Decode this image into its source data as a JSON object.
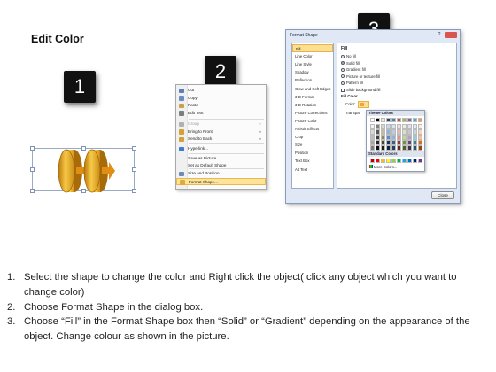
{
  "title": "Edit Color",
  "steps": {
    "one": "1",
    "two": "2",
    "three": "3"
  },
  "context_menu": {
    "items": [
      {
        "label": "Cut",
        "icon": "scissors-icon",
        "color": "#5b7fb8"
      },
      {
        "label": "Copy",
        "icon": "copy-icon",
        "color": "#6b8cc4"
      },
      {
        "label": "Paste",
        "icon": "paste-icon",
        "color": "#c8a148"
      },
      {
        "label": "Edit Text",
        "icon": "edit-text-icon",
        "color": "#7c7c7c"
      },
      {
        "label": "Group",
        "icon": "group-icon",
        "color": "#b0b0b0",
        "disabled": true,
        "submenu": true
      },
      {
        "label": "Bring to Front",
        "icon": "bring-front-icon",
        "color": "#d3a03c",
        "submenu": true
      },
      {
        "label": "Send to Back",
        "icon": "send-back-icon",
        "color": "#d3a03c",
        "submenu": true
      },
      {
        "label": "Hyperlink...",
        "icon": "hyperlink-icon",
        "color": "#3d7ad1"
      },
      {
        "label": "Save as Picture...",
        "icon": "none",
        "color": ""
      },
      {
        "label": "Set as Default Shape",
        "icon": "none",
        "color": ""
      },
      {
        "label": "Size and Position...",
        "icon": "size-position-icon",
        "color": "#6f8ab6"
      },
      {
        "label": "Format Shape...",
        "icon": "format-shape-icon",
        "color": "#e0a93a",
        "highlighted": true
      }
    ]
  },
  "dialog": {
    "title": "Format Shape",
    "categories": [
      "Fill",
      "Line Color",
      "Line Style",
      "Shadow",
      "Reflection",
      "Glow and Soft Edges",
      "3-D Format",
      "3-D Rotation",
      "Picture Corrections",
      "Picture Color",
      "Artistic Effects",
      "Crop",
      "Size",
      "Position",
      "Text Box",
      "Alt Text"
    ],
    "selected_category": "Fill",
    "section_title": "Fill",
    "fill_options": [
      "No fill",
      "Solid fill",
      "Gradient fill",
      "Picture or texture fill",
      "Pattern fill"
    ],
    "selected_fill": "Solid fill",
    "slide_background": "Slide background fill",
    "fill_color_label": "Fill Color",
    "color_label": "Color:",
    "transparency_label": "Transpar",
    "close_button": "Close"
  },
  "color_picker": {
    "theme_header": "Theme Colors",
    "standard_header": "Standard Colors",
    "more_colors": "More Colors...",
    "theme_top": [
      "#ffffff",
      "#000000",
      "#eeece1",
      "#1f497d",
      "#4f81bd",
      "#c0504d",
      "#9bbb59",
      "#8064a2",
      "#4bacc6",
      "#f79646"
    ],
    "theme_columns": [
      [
        "#f2f2f2",
        "#d9d9d9",
        "#bfbfbf",
        "#a6a6a6",
        "#7f7f7f"
      ],
      [
        "#7f7f7f",
        "#595959",
        "#404040",
        "#262626",
        "#0d0d0d"
      ],
      [
        "#ddd9c3",
        "#c4bd97",
        "#948a54",
        "#4a452a",
        "#1e1c11"
      ],
      [
        "#c6d9f0",
        "#8db3e2",
        "#548dd4",
        "#17365d",
        "#0f243e"
      ],
      [
        "#dbe5f1",
        "#b8cce4",
        "#95b3d7",
        "#366092",
        "#244061"
      ],
      [
        "#f2dcdb",
        "#e6b9b8",
        "#d99694",
        "#953734",
        "#632423"
      ],
      [
        "#ebf1dd",
        "#d7e3bc",
        "#c3d69b",
        "#76923c",
        "#4f6128"
      ],
      [
        "#e5e0ec",
        "#ccc1d9",
        "#b2a2c7",
        "#5f497a",
        "#3f3151"
      ],
      [
        "#dbeef3",
        "#b7dde8",
        "#92cddc",
        "#31859b",
        "#205867"
      ],
      [
        "#fdeada",
        "#fbd5b5",
        "#fac08f",
        "#e36c09",
        "#974806"
      ]
    ],
    "standard": [
      "#c00000",
      "#ff0000",
      "#ffc000",
      "#ffff00",
      "#92d050",
      "#00b050",
      "#00b0f0",
      "#0070c0",
      "#002060",
      "#7030a0"
    ]
  },
  "shape_colors": {
    "coin_light": "#f6c342",
    "coin_dark": "#c98a12",
    "arrow": "#e79a1c"
  },
  "instructions": [
    {
      "num": "1.",
      "text": "Select the shape to change the color and Right click the object( click any object which you want to change color)"
    },
    {
      "num": "2.",
      "text": "Choose Format Shape in the dialog box."
    },
    {
      "num": "3.",
      "text": "Choose “Fill” in the Format Shape box then “Solid” or “Gradient” depending on the appearance of the object. Change colour as shown in the picture."
    }
  ]
}
